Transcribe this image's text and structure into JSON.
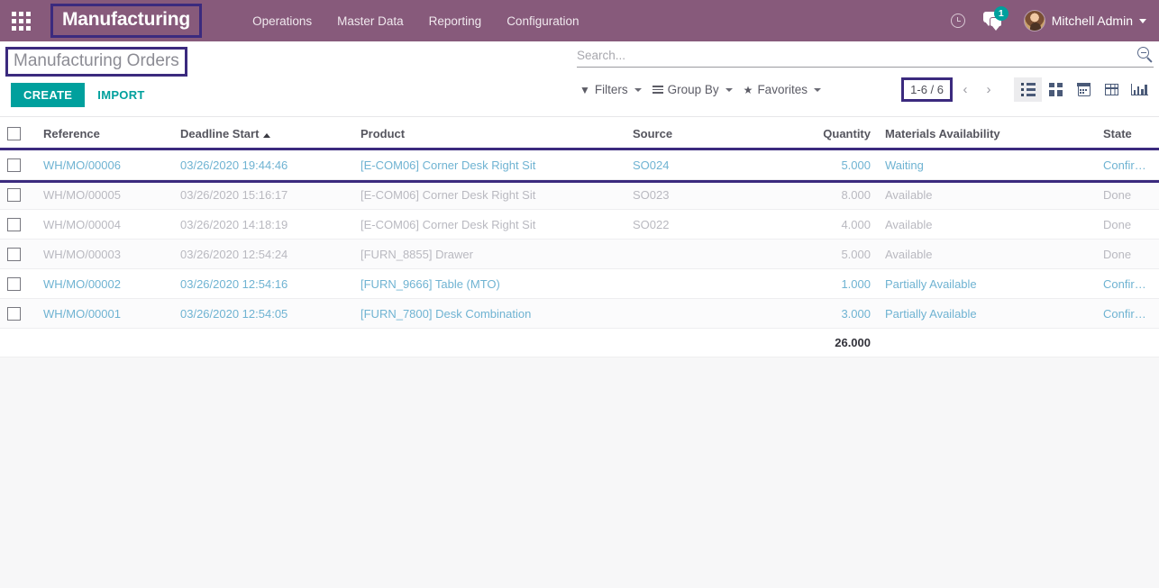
{
  "navbar": {
    "apps_icon": "apps-grid-icon",
    "brand": "Manufacturing",
    "menu": [
      {
        "label": "Operations"
      },
      {
        "label": "Master Data"
      },
      {
        "label": "Reporting"
      },
      {
        "label": "Configuration"
      }
    ],
    "activity_icon": "clock-icon",
    "messages_icon": "chat-bubble-icon",
    "messages_badge": "1",
    "user_name": "Mitchell Admin",
    "user_caret": "caret-down-icon",
    "background_color": "#875A7B"
  },
  "control_panel": {
    "breadcrumb": "Manufacturing Orders",
    "create_label": "CREATE",
    "import_label": "IMPORT",
    "accent_color": "#00A09D",
    "search": {
      "placeholder": "Search...",
      "value": "",
      "icon": "search-icon"
    },
    "filters_label": "Filters",
    "group_by_label": "Group By",
    "favorites_label": "Favorites",
    "pager": "1-6 / 6",
    "prev_icon": "chevron-left-icon",
    "next_icon": "chevron-right-icon",
    "views": [
      {
        "name": "list",
        "label": "List",
        "active": true
      },
      {
        "name": "kanban",
        "label": "Kanban",
        "active": false
      },
      {
        "name": "calendar",
        "label": "Calendar",
        "active": false
      },
      {
        "name": "pivot",
        "label": "Pivot",
        "active": false
      },
      {
        "name": "graph",
        "label": "Graph",
        "active": false
      }
    ]
  },
  "table": {
    "columns": [
      {
        "key": "reference",
        "label": "Reference",
        "sorted": false
      },
      {
        "key": "deadline_start",
        "label": "Deadline Start",
        "sorted": true,
        "sort_dir": "asc"
      },
      {
        "key": "product",
        "label": "Product",
        "sorted": false
      },
      {
        "key": "source",
        "label": "Source",
        "sorted": false
      },
      {
        "key": "quantity",
        "label": "Quantity",
        "sorted": false
      },
      {
        "key": "materials_availability",
        "label": "Materials Availability",
        "sorted": false
      },
      {
        "key": "state",
        "label": "State",
        "sorted": false
      }
    ],
    "rows": [
      {
        "reference": "WH/MO/00006",
        "deadline_start": "03/26/2020 19:44:46",
        "product": "[E-COM06] Corner Desk Right Sit",
        "source": "SO024",
        "quantity": "5.000",
        "materials_availability": "Waiting",
        "state": "Confirmed",
        "style": "link",
        "highlighted": true
      },
      {
        "reference": "WH/MO/00005",
        "deadline_start": "03/26/2020 15:16:17",
        "product": "[E-COM06] Corner Desk Right Sit",
        "source": "SO023",
        "quantity": "8.000",
        "materials_availability": "Available",
        "state": "Done",
        "style": "done",
        "highlighted": false
      },
      {
        "reference": "WH/MO/00004",
        "deadline_start": "03/26/2020 14:18:19",
        "product": "[E-COM06] Corner Desk Right Sit",
        "source": "SO022",
        "quantity": "4.000",
        "materials_availability": "Available",
        "state": "Done",
        "style": "done",
        "highlighted": false
      },
      {
        "reference": "WH/MO/00003",
        "deadline_start": "03/26/2020 12:54:24",
        "product": "[FURN_8855] Drawer",
        "source": "",
        "quantity": "5.000",
        "materials_availability": "Available",
        "state": "Done",
        "style": "done",
        "highlighted": false
      },
      {
        "reference": "WH/MO/00002",
        "deadline_start": "03/26/2020 12:54:16",
        "product": "[FURN_9666] Table (MTO)",
        "source": "",
        "quantity": "1.000",
        "materials_availability": "Partially Available",
        "state": "Confirmed",
        "style": "link",
        "highlighted": false
      },
      {
        "reference": "WH/MO/00001",
        "deadline_start": "03/26/2020 12:54:05",
        "product": "[FURN_7800] Desk Combination",
        "source": "",
        "quantity": "3.000",
        "materials_availability": "Partially Available",
        "state": "Confirmed",
        "style": "link",
        "highlighted": false
      }
    ],
    "total_quantity": "26.000"
  },
  "annotations": {
    "color": "#3b2a7e",
    "boxes": [
      "brand",
      "breadcrumb",
      "pager",
      "first-row"
    ]
  }
}
